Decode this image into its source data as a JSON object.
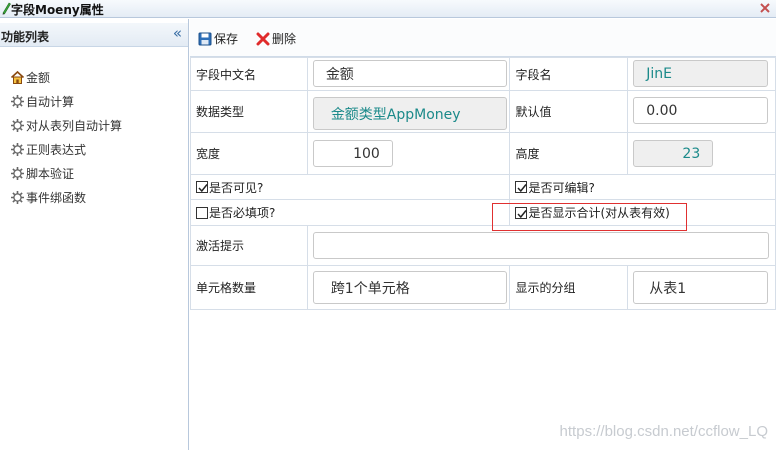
{
  "window": {
    "title": "字段Moeny属性"
  },
  "sidebar": {
    "title": "功能列表",
    "collapse_glyph": "«",
    "items": [
      {
        "label": "金额",
        "icon": "home-icon"
      },
      {
        "label": "自动计算",
        "icon": "gear-icon"
      },
      {
        "label": "对从表列自动计算",
        "icon": "gear-icon"
      },
      {
        "label": "正则表达式",
        "icon": "gear-icon"
      },
      {
        "label": "脚本验证",
        "icon": "gear-icon"
      },
      {
        "label": "事件绑函数",
        "icon": "gear-icon"
      }
    ]
  },
  "toolbar": {
    "save_label": "保存",
    "delete_label": "删除"
  },
  "form": {
    "name_cn_label": "字段中文名",
    "name_cn_value": "金额",
    "field_name_label": "字段名",
    "field_name_value": "JinE",
    "data_type_label": "数据类型",
    "data_type_value": "金额类型AppMoney",
    "default_label": "默认值",
    "default_value": "0.00",
    "width_label": "宽度",
    "width_value": "100",
    "height_label": "高度",
    "height_value": "23",
    "visible_label": "是否可见?",
    "visible_checked": true,
    "editable_label": "是否可编辑?",
    "editable_checked": true,
    "required_label": "是否必填项?",
    "required_checked": false,
    "show_sum_label": "是否显示合计(对从表有效)",
    "show_sum_checked": true,
    "activate_hint_label": "激活提示",
    "activate_hint_value": "",
    "cell_count_label": "单元格数量",
    "cell_count_value": "跨1个单元格",
    "group_label": "显示的分组",
    "group_value": "从表1"
  },
  "watermark": "https://blog.csdn.net/ccflow_LQ",
  "colors": {
    "accent": "#3a6ea5",
    "readonly_text": "#1b8a8a",
    "highlight_border": "#e03030"
  }
}
